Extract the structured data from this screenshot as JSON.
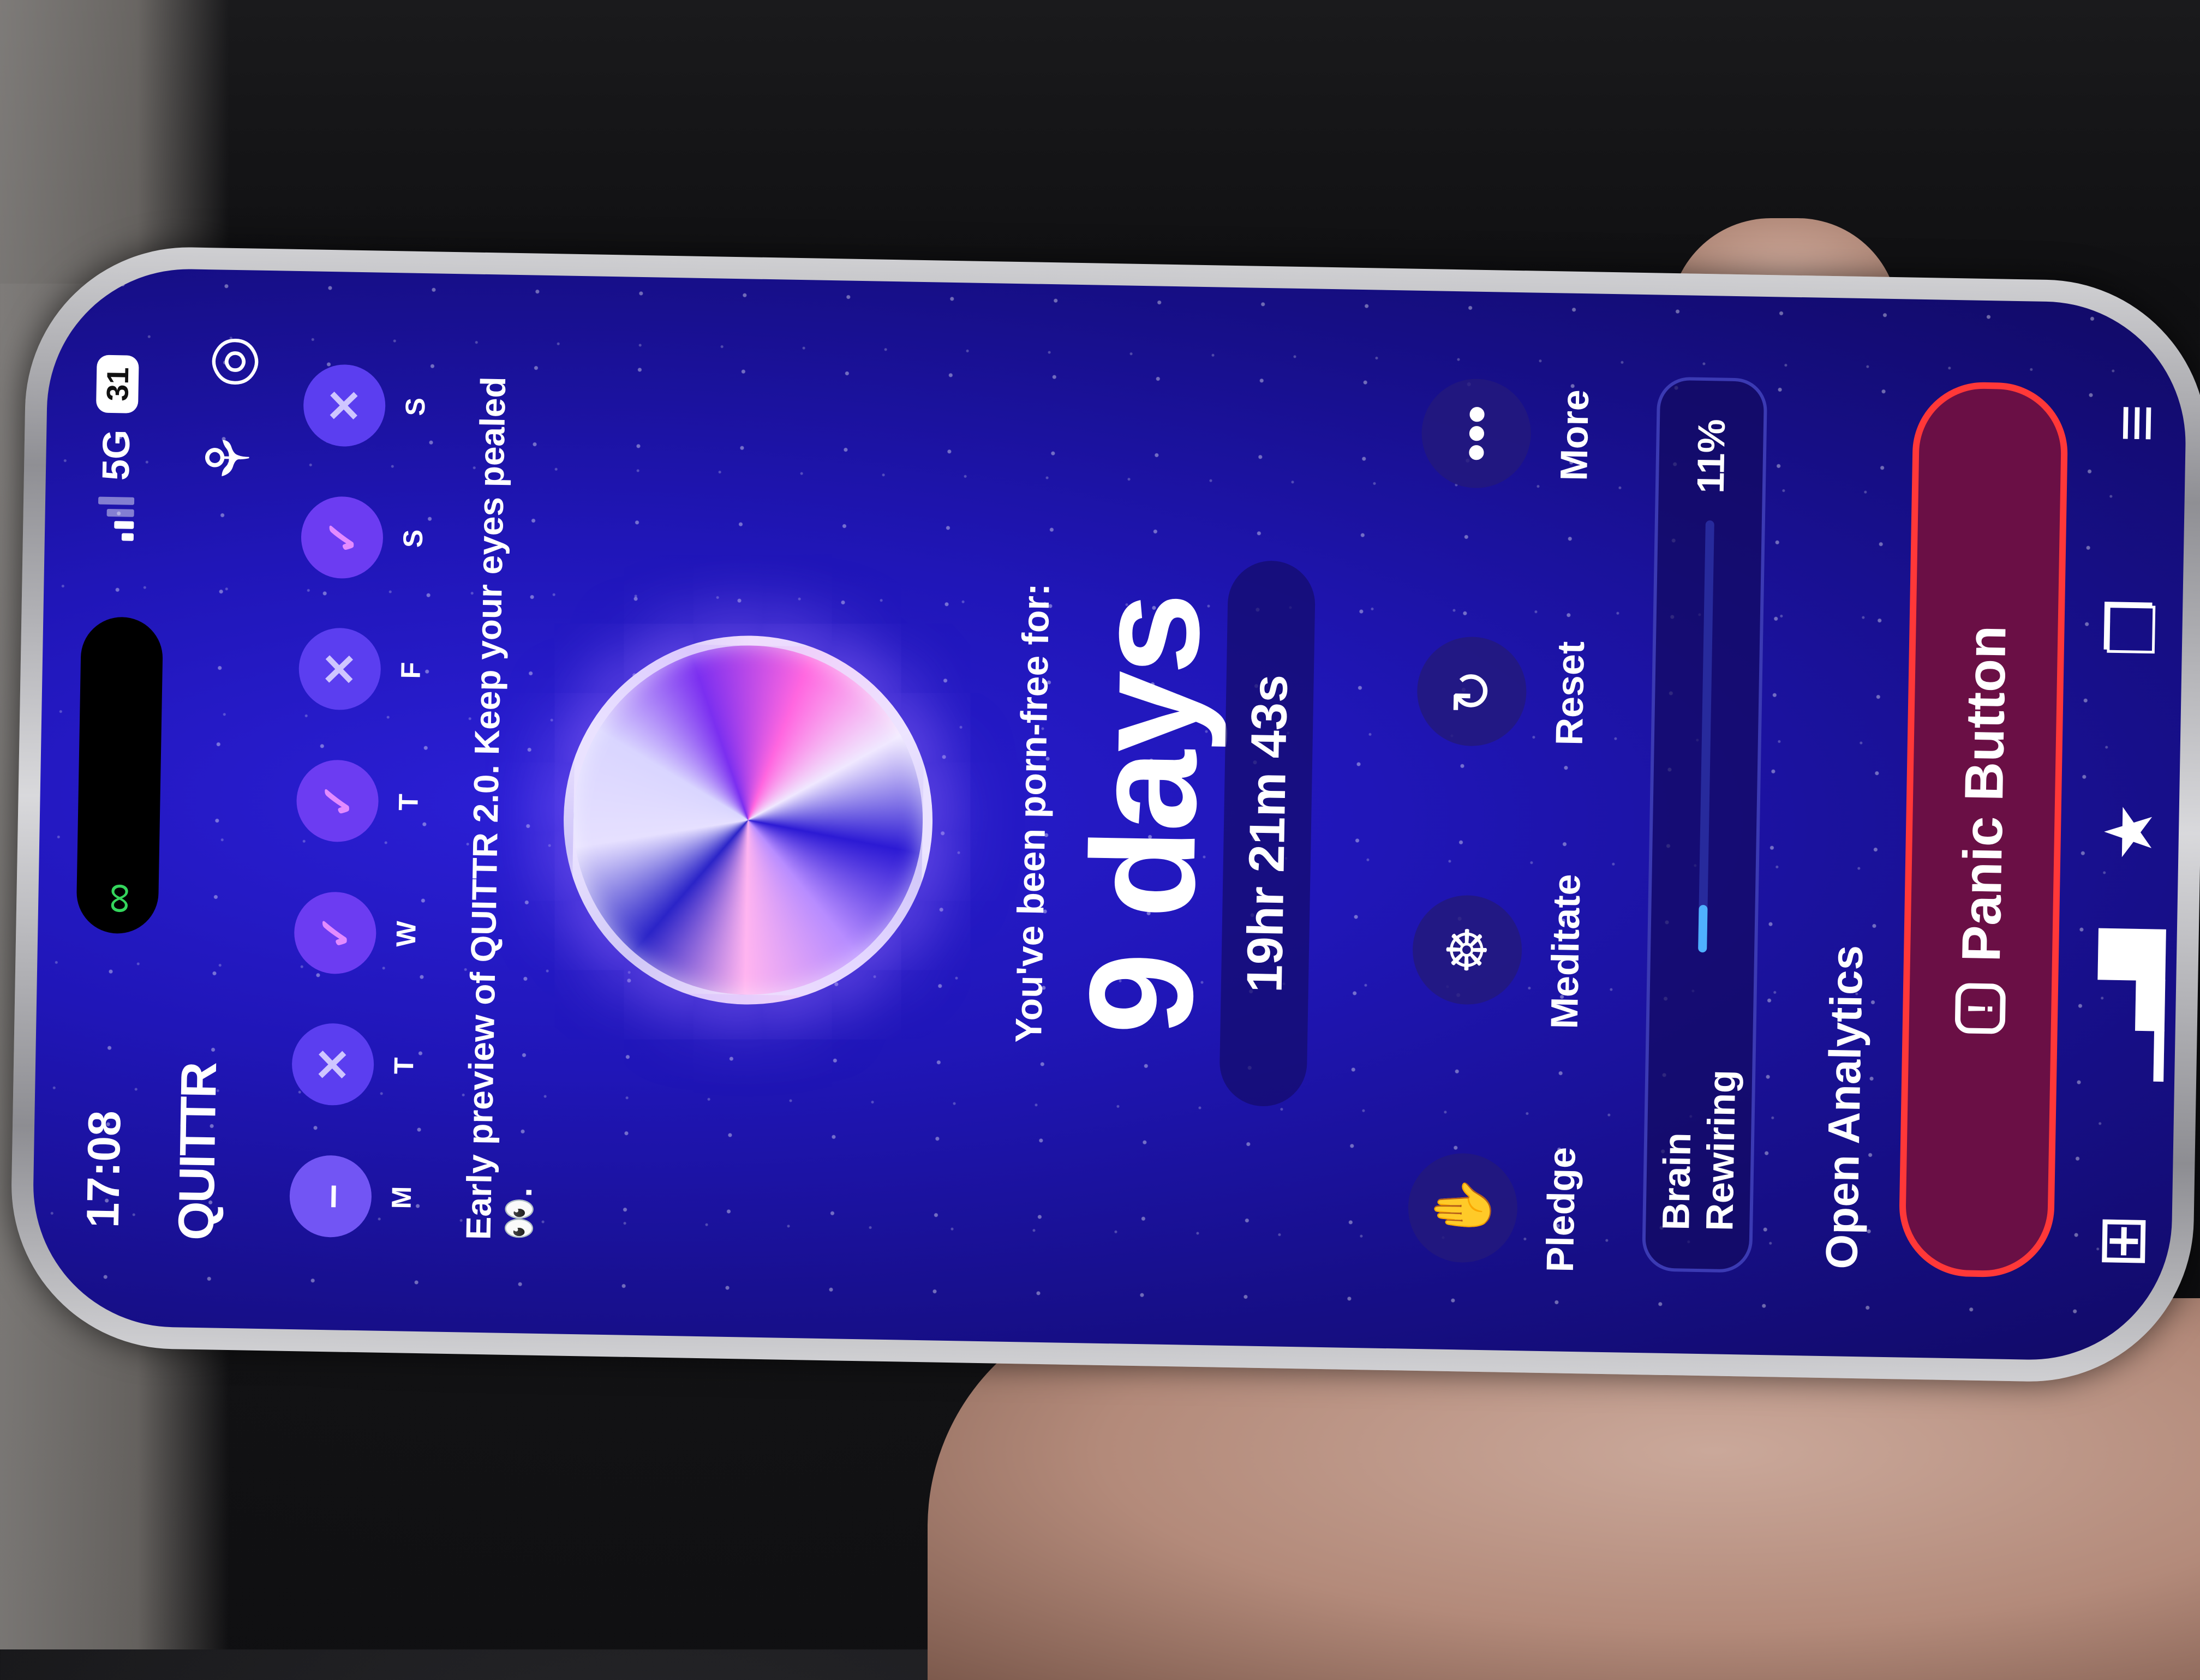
{
  "status_bar": {
    "time": "17:08",
    "network": "5G",
    "battery": "31",
    "island_icon": "link-icon"
  },
  "header": {
    "logo": "QUITTR",
    "icons": [
      "plant-icon",
      "target-icon"
    ]
  },
  "week": [
    {
      "label": "M",
      "state": "none",
      "mark": "–"
    },
    {
      "label": "T",
      "state": "x",
      "mark": "✕"
    },
    {
      "label": "W",
      "state": "ok",
      "mark": "✓"
    },
    {
      "label": "T",
      "state": "ok",
      "mark": "✓"
    },
    {
      "label": "F",
      "state": "x",
      "mark": "✕"
    },
    {
      "label": "S",
      "state": "ok",
      "mark": "✓"
    },
    {
      "label": "S",
      "state": "x",
      "mark": "✕"
    }
  ],
  "preview_text": "Early preview of QUITTR 2.0. Keep your eyes pealed 👀.",
  "streak": {
    "label": "You've been porn-free for:",
    "days": "9 days",
    "timer": "19hr 21m 43s"
  },
  "actions": [
    {
      "label": "Pledge",
      "icon": "hand-icon"
    },
    {
      "label": "Meditate",
      "icon": "meditate-icon"
    },
    {
      "label": "Reset",
      "icon": "reset-icon"
    },
    {
      "label": "More",
      "icon": "more-icon"
    }
  ],
  "brain_rewiring": {
    "label": "Brain Rewiring",
    "percent": "11%",
    "progress": 0.11
  },
  "open_analytics": "Open Analytics",
  "panic_button": {
    "label": "Panic Button",
    "icon": "alert-icon"
  },
  "tabbar": [
    "grid-icon",
    "chart-icon",
    "star-card-icon",
    "chat-icon",
    "menu-icon"
  ],
  "colors": {
    "accent": "#6a4cf0",
    "panic_border": "#ff3838",
    "panic_bg": "#6a0f45"
  }
}
